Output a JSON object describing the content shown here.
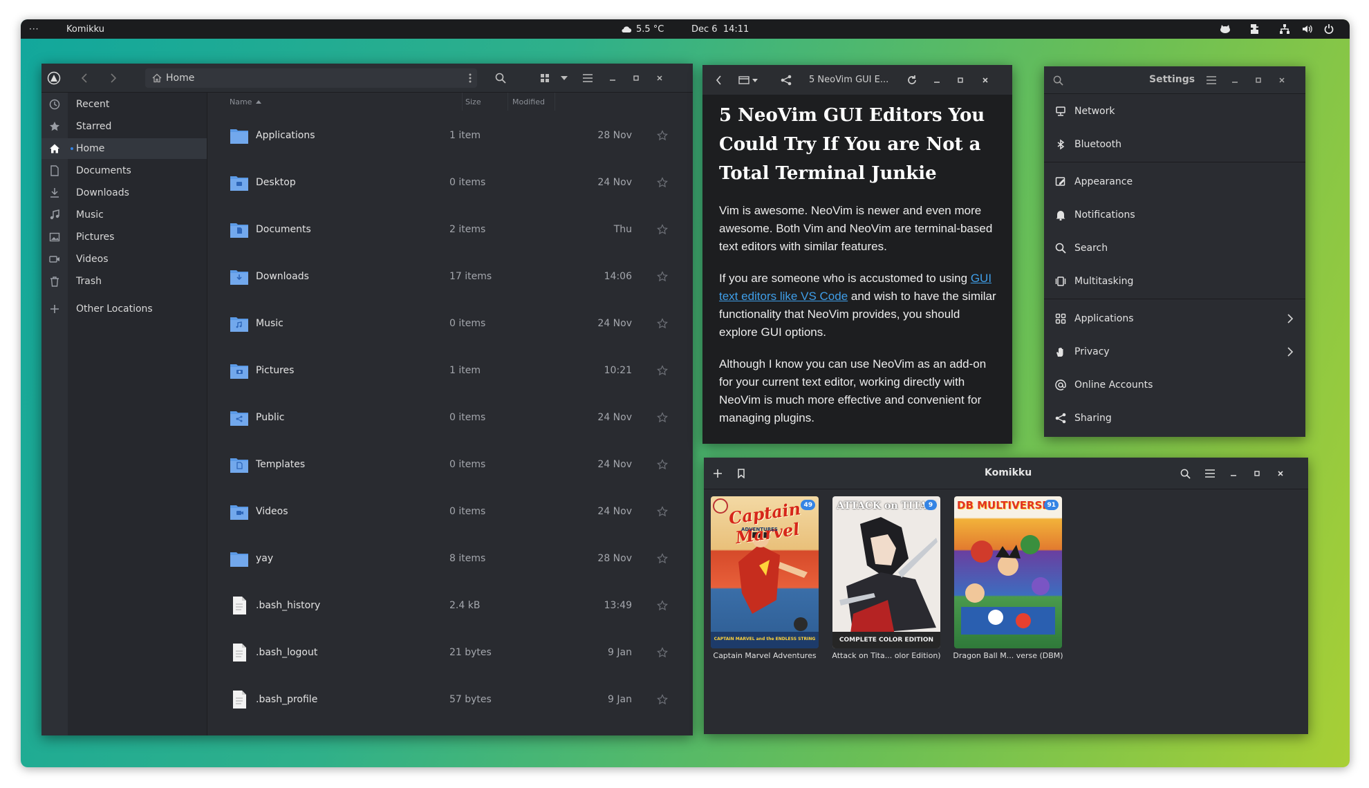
{
  "topbar": {
    "activities": "···",
    "app_name": "Komikku",
    "weather": "5.5 °C",
    "datetime": "Dec 6  14:11"
  },
  "files": {
    "path": "Home",
    "columns": {
      "name": "Name",
      "size": "Size",
      "modified": "Modified"
    },
    "sidebar": [
      {
        "label": "Recent",
        "icon": "clock-icon"
      },
      {
        "label": "Starred",
        "icon": "star-icon"
      },
      {
        "label": "Home",
        "icon": "home-icon",
        "active": true
      },
      {
        "label": "Documents",
        "icon": "document-icon"
      },
      {
        "label": "Downloads",
        "icon": "download-icon"
      },
      {
        "label": "Music",
        "icon": "music-icon"
      },
      {
        "label": "Pictures",
        "icon": "picture-icon"
      },
      {
        "label": "Videos",
        "icon": "video-icon"
      },
      {
        "label": "Trash",
        "icon": "trash-icon"
      },
      {
        "label": "Other Locations",
        "icon": "plus-icon"
      }
    ],
    "rows": [
      {
        "name": "Applications",
        "size": "1 item",
        "modified": "28 Nov",
        "type": "folder"
      },
      {
        "name": "Desktop",
        "size": "0 items",
        "modified": "24 Nov",
        "type": "folder"
      },
      {
        "name": "Documents",
        "size": "2 items",
        "modified": "Thu",
        "type": "folder"
      },
      {
        "name": "Downloads",
        "size": "17 items",
        "modified": "14:06",
        "type": "folder"
      },
      {
        "name": "Music",
        "size": "0 items",
        "modified": "24 Nov",
        "type": "folder"
      },
      {
        "name": "Pictures",
        "size": "1 item",
        "modified": "10:21",
        "type": "folder"
      },
      {
        "name": "Public",
        "size": "0 items",
        "modified": "24 Nov",
        "type": "folder"
      },
      {
        "name": "Templates",
        "size": "0 items",
        "modified": "24 Nov",
        "type": "folder"
      },
      {
        "name": "Videos",
        "size": "0 items",
        "modified": "24 Nov",
        "type": "folder"
      },
      {
        "name": "yay",
        "size": "8 items",
        "modified": "28 Nov",
        "type": "folder"
      },
      {
        "name": ".bash_history",
        "size": "2.4 kB",
        "modified": "13:49",
        "type": "file"
      },
      {
        "name": ".bash_logout",
        "size": "21 bytes",
        "modified": "9 Jan",
        "type": "file"
      },
      {
        "name": ".bash_profile",
        "size": "57 bytes",
        "modified": "9 Jan",
        "type": "file"
      }
    ]
  },
  "article": {
    "tab_title": "5 NeoVim GUI E...",
    "heading": "5 NeoVim GUI Editors You Could Try If You are Not a Total Terminal Junkie",
    "p1": "Vim is awesome. NeoVim is newer and even more awesome. Both Vim and NeoVim are terminal-based text editors with similar features.",
    "p2_before": "If you are someone who is accustomed to using ",
    "p2_link": "GUI text editors like VS Code",
    "p2_after": " and wish to have the similar functionality that NeoVim provides, you should explore GUI options.",
    "p3": "Although I know you can use NeoVim as an add-on for your current text editor, working directly with NeoVim is much more effective and convenient for managing plugins."
  },
  "settings": {
    "title": "Settings",
    "groups": [
      [
        {
          "label": "Network",
          "icon": "network-icon"
        },
        {
          "label": "Bluetooth",
          "icon": "bluetooth-icon"
        }
      ],
      [
        {
          "label": "Appearance",
          "icon": "appearance-icon"
        },
        {
          "label": "Notifications",
          "icon": "bell-icon"
        },
        {
          "label": "Search",
          "icon": "search-icon"
        },
        {
          "label": "Multitasking",
          "icon": "multitasking-icon"
        }
      ],
      [
        {
          "label": "Applications",
          "icon": "apps-grid-icon",
          "chevron": true
        },
        {
          "label": "Privacy",
          "icon": "hand-icon",
          "chevron": true
        },
        {
          "label": "Online Accounts",
          "icon": "at-icon"
        },
        {
          "label": "Sharing",
          "icon": "share-icon"
        }
      ]
    ]
  },
  "komikku": {
    "title": "Komikku",
    "books": [
      {
        "title": "Captain Marvel Adventures",
        "badge": "49",
        "cover_title": "Captain Marvel",
        "cover_subtitle": "ADVENTURES",
        "cover_footer": "CAPTAIN MARVEL and the ENDLESS STRING"
      },
      {
        "title": "Attack on Tita... olor Edition)",
        "badge": "9",
        "cover_title": "ATTACK on TITAN",
        "cover_footer": "COMPLETE COLOR EDITION"
      },
      {
        "title": "Dragon Ball M... verse (DBM)",
        "badge": "91",
        "cover_title": "DB MULTIVERSE"
      }
    ]
  },
  "colors": {
    "accent": "#3584e4",
    "folder": "#5b9ae6",
    "link": "#3f9ee8",
    "window_bg": "#26282d"
  }
}
